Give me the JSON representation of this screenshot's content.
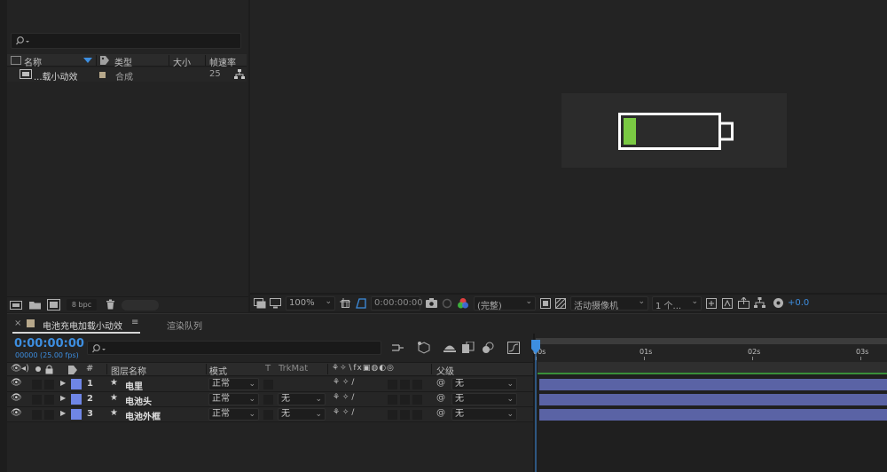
{
  "project": {
    "columns": {
      "name": "名称",
      "type": "类型",
      "size": "大小",
      "fps": "帧速率"
    },
    "items": [
      {
        "name": "...载小动效",
        "type": "合成",
        "fps": "25"
      }
    ],
    "bpc": "8 bpc"
  },
  "viewer": {
    "zoom": "100%",
    "timecode": "0:00:00:00",
    "resolution": "(完整)",
    "camera": "活动摄像机",
    "views": "1 个...",
    "exposure": "+0.0",
    "battery_fill_color": "#7ac943"
  },
  "timeline": {
    "tabs": [
      {
        "label": "电池充电加载小动效"
      },
      {
        "label": "渲染队列"
      }
    ],
    "current_time": "0:00:00:00",
    "frame_info": "00000 (25.00 fps)",
    "columns": {
      "number": "#",
      "layer_name": "图层名称",
      "mode": "模式",
      "t": "T",
      "trkmat": "TrkMat",
      "parent": "父级"
    },
    "layers": [
      {
        "num": "1",
        "name": "电里",
        "mode": "正常",
        "trkmat": "",
        "parent": "无"
      },
      {
        "num": "2",
        "name": "电池头",
        "mode": "正常",
        "trkmat": "无",
        "parent": "无"
      },
      {
        "num": "3",
        "name": "电池外框",
        "mode": "正常",
        "trkmat": "无",
        "parent": "无"
      }
    ],
    "ruler": [
      "00s",
      "01s",
      "02s",
      "03s"
    ],
    "layer_color": "#6f86e6",
    "bar_color": "#5a63a5"
  }
}
